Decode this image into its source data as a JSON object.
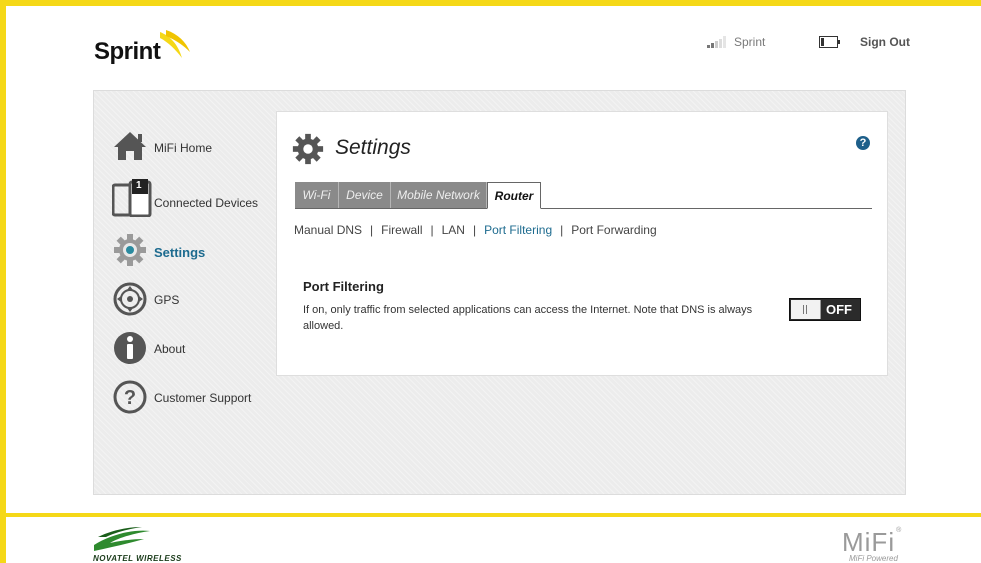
{
  "brand": {
    "logo_text": "Sprint",
    "accent_color": "#f5d817",
    "link_color": "#1d6b8f"
  },
  "header": {
    "carrier": "Sprint",
    "sign_out": "Sign Out"
  },
  "sidebar": {
    "items": [
      {
        "label": "MiFi Home",
        "icon": "home-icon"
      },
      {
        "label": "Connected Devices",
        "icon": "devices-icon",
        "badge": "1"
      },
      {
        "label": "Settings",
        "icon": "gear-icon",
        "active": true
      },
      {
        "label": "GPS",
        "icon": "gps-icon"
      },
      {
        "label": "About",
        "icon": "info-icon"
      },
      {
        "label": "Customer Support",
        "icon": "question-icon"
      }
    ]
  },
  "main": {
    "title": "Settings",
    "help": "?",
    "tabs": [
      {
        "label": "Wi-Fi"
      },
      {
        "label": "Device"
      },
      {
        "label": "Mobile Network"
      },
      {
        "label": "Router",
        "active": true
      }
    ],
    "subnav": [
      {
        "label": "Manual DNS"
      },
      {
        "label": "Firewall"
      },
      {
        "label": "LAN"
      },
      {
        "label": "Port Filtering",
        "active": true
      },
      {
        "label": "Port Forwarding"
      }
    ],
    "port_filtering": {
      "title": "Port Filtering",
      "description": "If on, only traffic from selected applications can access the Internet. Note that DNS is always allowed.",
      "toggle_state": "OFF"
    }
  },
  "footer": {
    "novatel_logo": "NOVATEL WIRELESS",
    "mifi_logo": "MiFi",
    "mifi_registered": "®",
    "mifi_powered": "MiFi Powered"
  }
}
